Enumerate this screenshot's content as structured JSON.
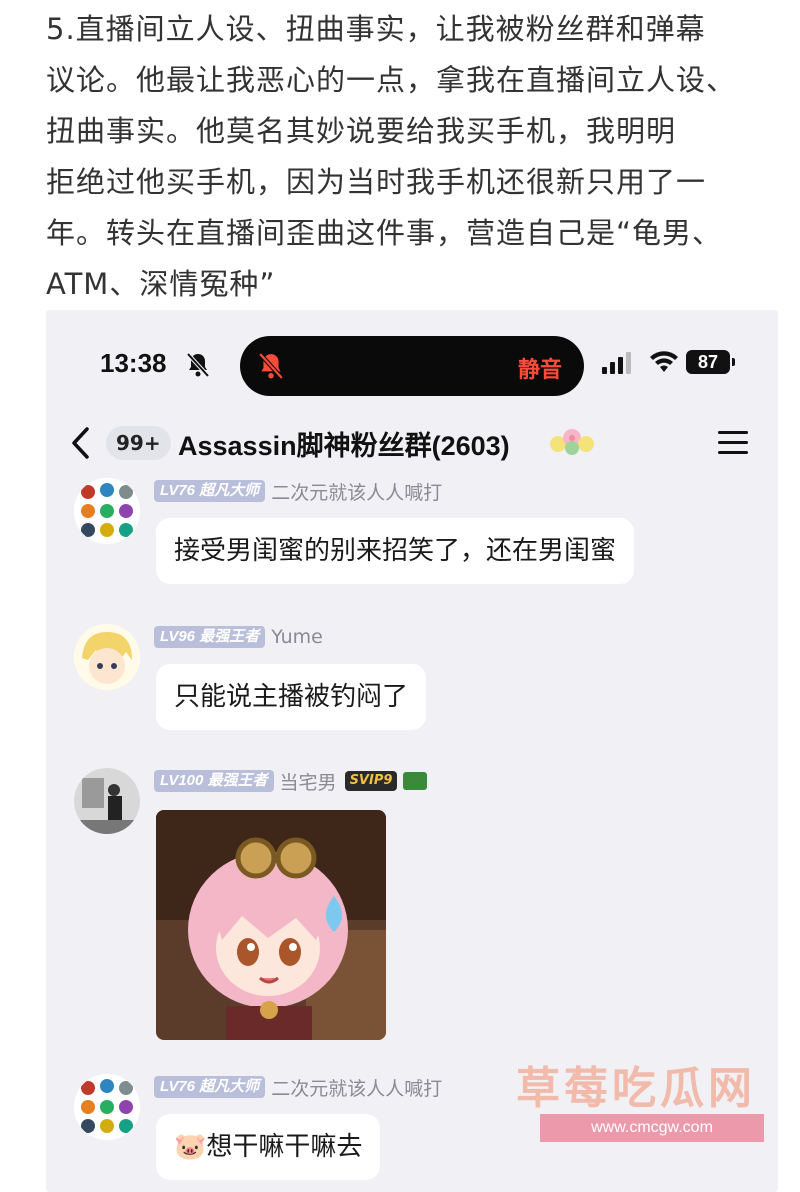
{
  "post": {
    "lines": [
      "5.直播间立人设、扭曲事实，让我被粉丝群和弹幕",
      "议论。他最让我恶心的一点，拿我在直播间立人设、",
      "扭曲事实。他莫名其妙说要给我买手机，我明明",
      "拒绝过他买手机，因为当时我手机还很新只用了一",
      "年。转头在直播间歪曲这件事，营造自己是“龟男、",
      "ATM、深情冤种”"
    ]
  },
  "status_bar": {
    "time": "13:38",
    "island_label": "静音",
    "battery": "87"
  },
  "header": {
    "unread_badge": "99+",
    "group_title": "Assassin脚神粉丝群(2603)"
  },
  "messages": [
    {
      "level": "LV76 超凡大师",
      "nickname": "二次元就该人人喊打",
      "text": "接受男闺蜜的别来招笑了，还在男闺蜜"
    },
    {
      "level": "LV96 最强王者",
      "nickname": "Yume",
      "text": "只能说主播被钓闷了"
    },
    {
      "level": "LV100 最强王者",
      "nickname": "当宅男",
      "vip": "SVIP9",
      "text": ""
    },
    {
      "level": "LV76 超凡大师",
      "nickname": "二次元就该人人喊打",
      "text": "🐷想干嘛干嘛去"
    }
  ],
  "watermark": {
    "text": "草莓吃瓜网",
    "url": "www.cmcgw.com"
  },
  "colors": {
    "island_mute": "#ff4b3a",
    "level_badge": "#b9bedb",
    "chat_bg": "#f1f1f5"
  }
}
